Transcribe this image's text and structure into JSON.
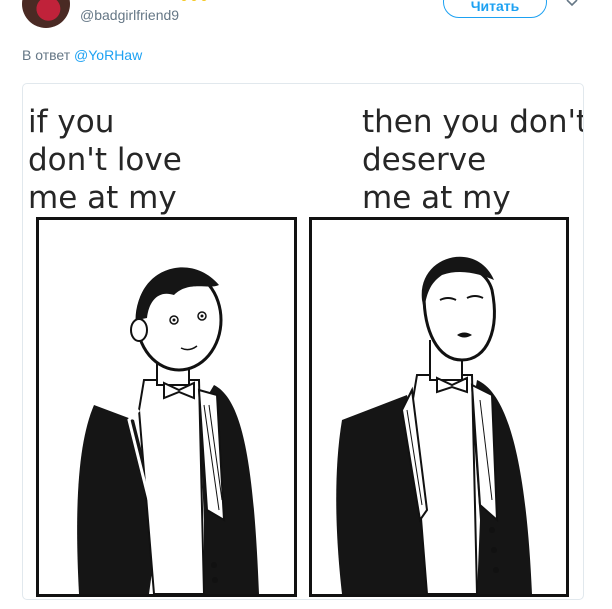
{
  "header": {
    "handle": "@badgirlfriend9",
    "follow_label": "Читать"
  },
  "reply_context": {
    "prefix": "В ответ",
    "mention": "@YoRHaw"
  },
  "meme": {
    "left_caption": "if you\ndon't love\nme at my",
    "right_caption": "then you don't\ndeserve\nme at my"
  },
  "colors": {
    "accent": "#1da1f2",
    "muted": "#657786",
    "border": "#e1e8ed"
  },
  "icons": {
    "dropdown": "chevron-down-icon"
  }
}
